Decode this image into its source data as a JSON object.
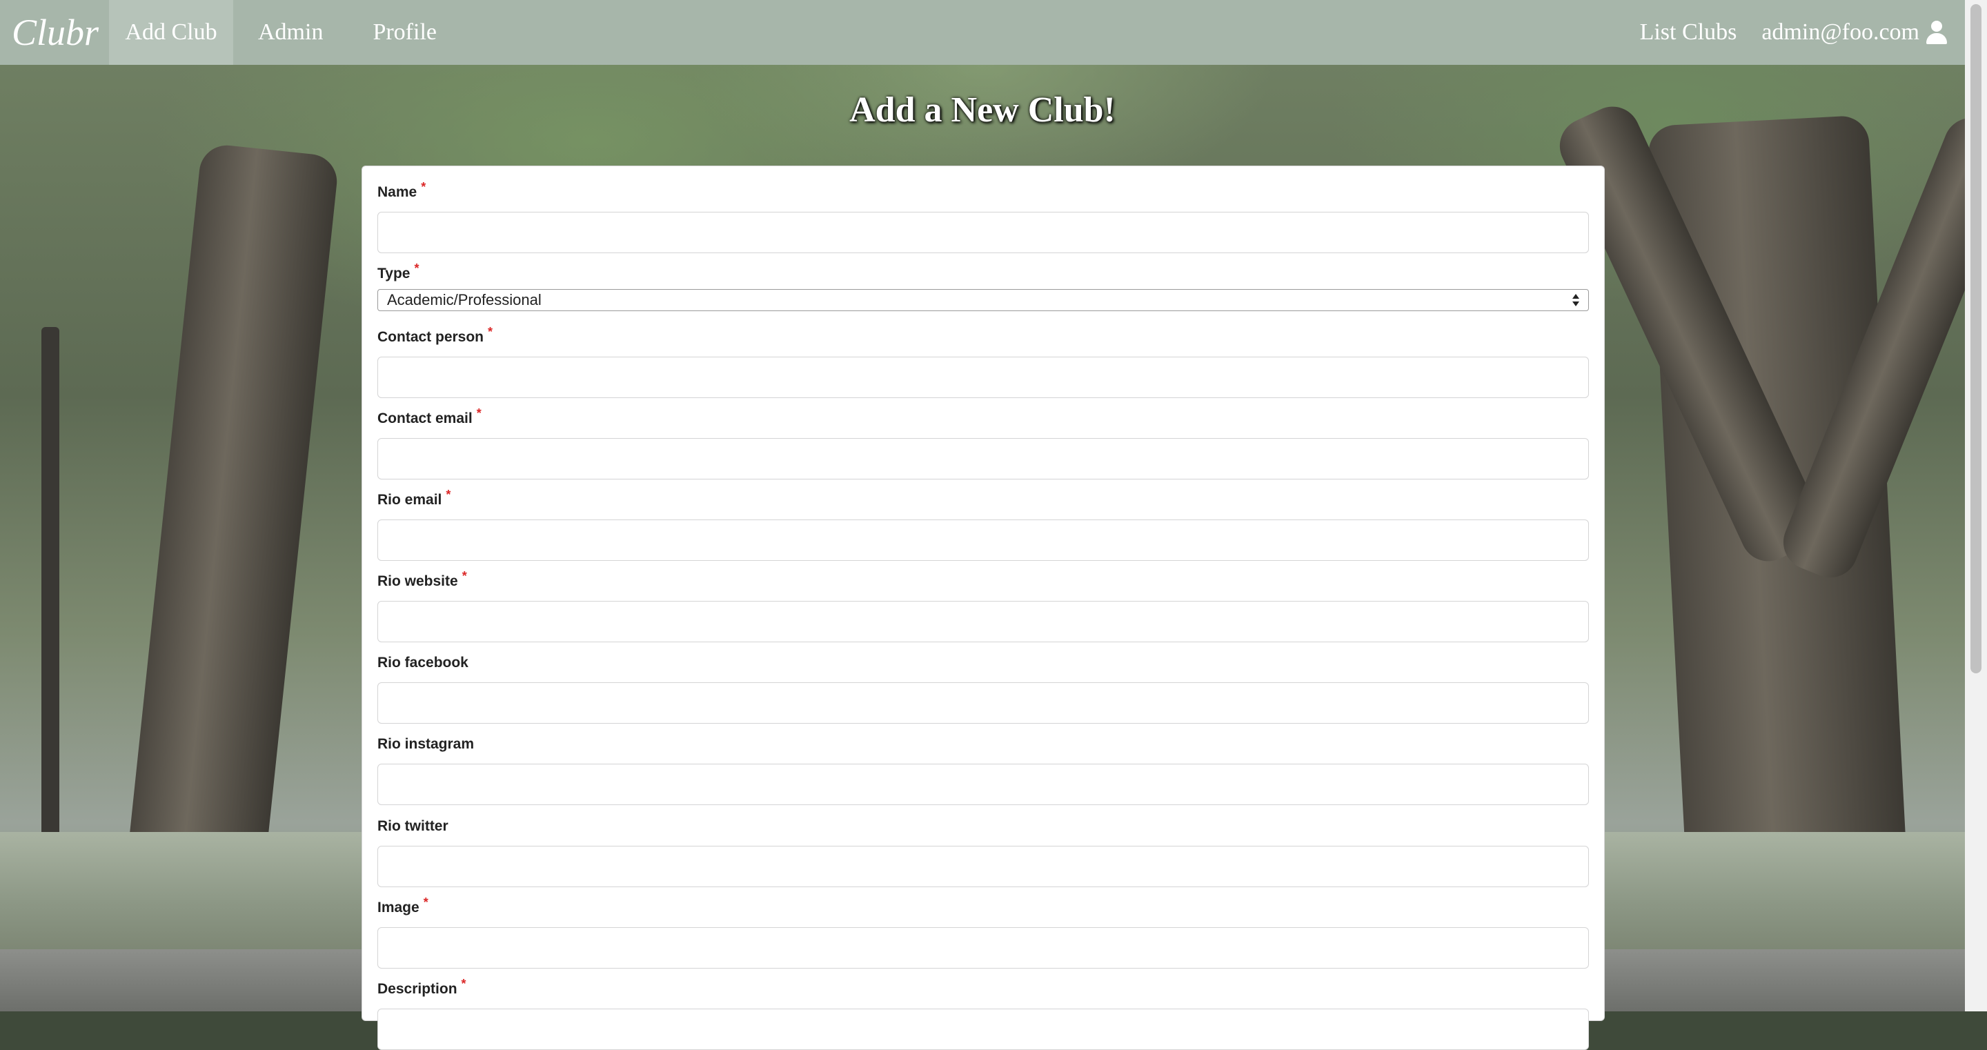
{
  "nav": {
    "brand": "Clubr",
    "add_club": "Add Club",
    "admin": "Admin",
    "profile": "Profile",
    "list_clubs": "List Clubs",
    "user_email": "admin@foo.com"
  },
  "page": {
    "title": "Add a New Club!"
  },
  "form": {
    "name_label": "Name",
    "type_label": "Type",
    "type_value": "Academic/Professional",
    "contact_person_label": "Contact person",
    "contact_email_label": "Contact email",
    "rio_email_label": "Rio email",
    "rio_website_label": "Rio website",
    "rio_facebook_label": "Rio facebook",
    "rio_instagram_label": "Rio instagram",
    "rio_twitter_label": "Rio twitter",
    "image_label": "Image",
    "description_label": "Description",
    "required_mark": "*"
  },
  "colors": {
    "navbar": "#a7b6aa",
    "required": "#db2828"
  },
  "icons": {
    "user": "user-icon",
    "select": "select-arrows-icon"
  }
}
